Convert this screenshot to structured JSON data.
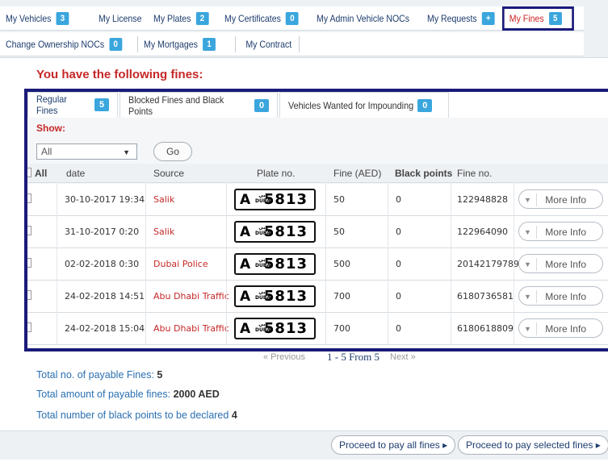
{
  "tabs": [
    {
      "label": "My Vehicles",
      "count": "3"
    },
    {
      "label": "My License",
      "count": ""
    },
    {
      "label": "My Plates",
      "count": "2"
    },
    {
      "label": "My Certificates",
      "count": "0"
    },
    {
      "label": "My Admin Vehicle NOCs",
      "count": ""
    },
    {
      "label": "My Requests",
      "count": "+"
    },
    {
      "label": "My Fines",
      "count": "5"
    },
    {
      "label": "Change Ownership NOCs",
      "count": "0"
    },
    {
      "label": "My Mortgages",
      "count": "1"
    },
    {
      "label": "My Contract",
      "count": ""
    }
  ],
  "heading": "You have the following fines:",
  "subtabs": [
    {
      "label": "Regular Fines",
      "count": "5"
    },
    {
      "label": "Blocked Fines and Black Points",
      "count": "0"
    },
    {
      "label": "Vehicles Wanted for Impounding",
      "count": "0"
    }
  ],
  "filter": {
    "show_label": "Show:",
    "selected": "All",
    "go_label": "Go"
  },
  "table": {
    "headers": [
      "All",
      "date",
      "Source",
      "Plate no.",
      "Fine (AED)",
      "Black points",
      "Fine no."
    ],
    "rows": [
      {
        "date": "30-10-2017 19:34",
        "source": "Salik",
        "plate_code": "A",
        "plate_number": "5813",
        "fine": "50",
        "black_points": "0",
        "fine_no": "122948828",
        "action": "More Info"
      },
      {
        "date": "31-10-2017 0:20",
        "source": "Salik",
        "plate_code": "A",
        "plate_number": "5813",
        "fine": "50",
        "black_points": "0",
        "fine_no": "122964090",
        "action": "More Info"
      },
      {
        "date": "02-02-2018 0:30",
        "source": "Dubai Police",
        "plate_code": "A",
        "plate_number": "5813",
        "fine": "500",
        "black_points": "0",
        "fine_no": "20142179789",
        "action": "More Info"
      },
      {
        "date": "24-02-2018 14:51",
        "source": "Abu Dhabi Traffic",
        "plate_code": "A",
        "plate_number": "5813",
        "fine": "700",
        "black_points": "0",
        "fine_no": "6180736581",
        "action": "More Info"
      },
      {
        "date": "24-02-2018 15:04",
        "source": "Abu Dhabi Traffic",
        "plate_code": "A",
        "plate_number": "5813",
        "fine": "700",
        "black_points": "0",
        "fine_no": "6180618809",
        "action": "More Info"
      }
    ],
    "plate_emblem_arabic": "دبي",
    "plate_emblem_latin": "DUBAI"
  },
  "pagination": {
    "previous": "« Previous",
    "info": "1 - 5  From 5",
    "next": "Next »"
  },
  "totals": {
    "fines_label": "Total no. of payable Fines:",
    "fines_value": "5",
    "amount_label": "Total amount of payable fines:",
    "amount_value": "2000 AED",
    "points_label": "Total number of black points to be declared",
    "points_value": "4"
  },
  "footer": {
    "pay_all": "Proceed to pay all fines ▸",
    "pay_selected": "Proceed to pay selected fines ▸"
  },
  "colors": {
    "accent_red": "#c62828",
    "badge_blue": "#3aa6dd",
    "frame_navy": "#1a1a7a",
    "link_blue": "#2a6fb0"
  }
}
